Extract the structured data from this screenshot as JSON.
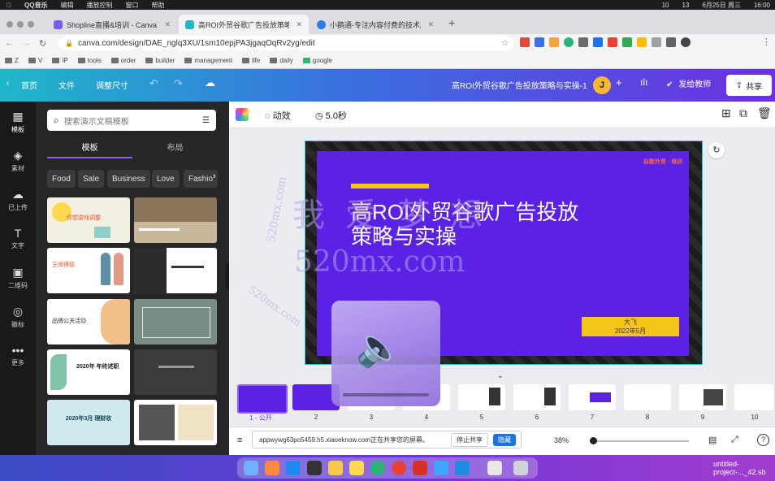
{
  "mac_menu": {
    "app": "QQ音乐",
    "items": [
      "编辑",
      "播放控制",
      "窗口",
      "帮助"
    ],
    "status": [
      "10",
      "13",
      "6月25日 周三",
      "16:00"
    ]
  },
  "tabs": [
    {
      "title": "Shopline直播&培训 - Canva可画",
      "color": "#7b5cf0"
    },
    {
      "title": "高ROI外贸谷歌广告投放策略与实操",
      "color": "#22b7c7"
    },
    {
      "title": "小鹅通-专注内容付费的技术服务商",
      "color": "#2d7be6"
    }
  ],
  "address": {
    "url": "canva.com/design/DAE_nglq3XU/1sm10epjPA3jgaqOqRv2yg/edit"
  },
  "bookmarks": [
    "Z",
    "V",
    "IP",
    "tools",
    "order",
    "builder",
    "management",
    "life",
    "daily",
    "google"
  ],
  "canva_top": {
    "home": "首页",
    "file": "文件",
    "resize": "调整尺寸",
    "doc_title": "高ROI外贸谷歌广告投放策略与实操-1",
    "avatar": "J",
    "present": "发给教师",
    "share": "共享"
  },
  "rail": [
    {
      "label": "模板",
      "icon": "template-icon"
    },
    {
      "label": "素材",
      "icon": "elements-icon"
    },
    {
      "label": "已上传",
      "icon": "upload-icon"
    },
    {
      "label": "文字",
      "icon": "text-icon"
    },
    {
      "label": "二维码",
      "icon": "qr-icon"
    },
    {
      "label": "徽标",
      "icon": "logo-icon"
    },
    {
      "label": "更多",
      "icon": "more-icon"
    }
  ],
  "panel": {
    "search_placeholder": "搜索演示文稿模板",
    "tab_templates": "模板",
    "tab_layouts": "布局",
    "chips": [
      "Food",
      "Sale",
      "Business",
      "Love",
      "Fashio"
    ],
    "thumb_texts": [
      "你想游戏调整",
      "",
      "王师傅德",
      "",
      "品牌公关活动",
      "",
      "2020年 年终述职",
      "",
      "2020年3月 理财收",
      ""
    ]
  },
  "editor_toolbar": {
    "animate": "动效",
    "duration": "5.0秒"
  },
  "slide": {
    "brand": "谷歌外贸 · 培训",
    "title_line1": "高ROI外贸谷歌广告投放",
    "title_line2": "策略与实操",
    "speaker": "大飞",
    "date": "2022年5月"
  },
  "page_thumbs": {
    "labels": [
      "1 - 公开",
      "2",
      "3",
      "4",
      "5",
      "6",
      "7",
      "8",
      "9",
      "10"
    ]
  },
  "bottom": {
    "zoom": "38%"
  },
  "notice": {
    "text": "appwywg63po5459.h5.xiaoeknow.com正在共享您的屏幕。",
    "stop": "停止共享",
    "hide": "隐藏"
  },
  "watermarks": [
    "我 爱 梦 想",
    "520mx.com",
    "520mx.com",
    "520mx.com",
    "520mx.com"
  ],
  "dock_file": "untitled-project-..._42.sb"
}
